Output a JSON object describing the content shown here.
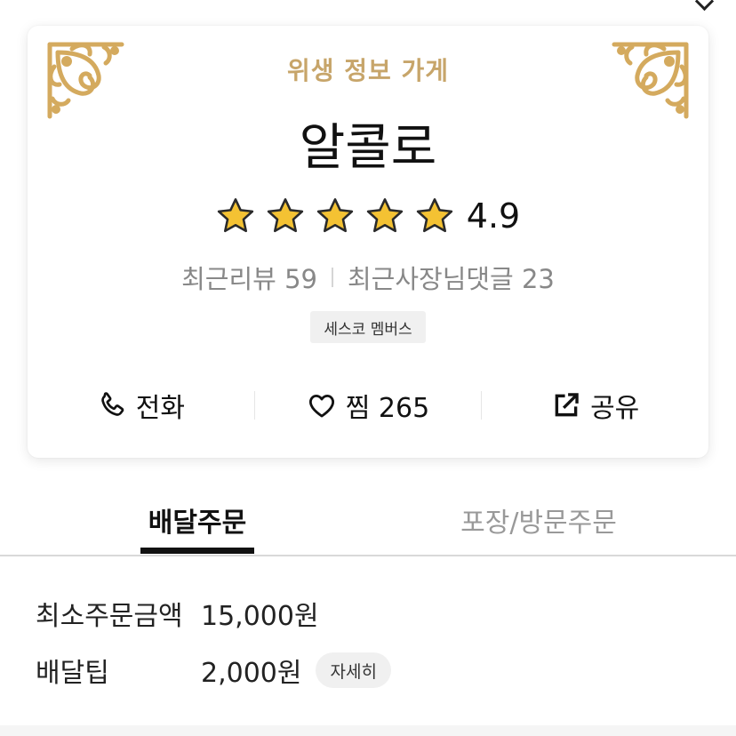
{
  "store": {
    "hygiene_label": "위생 정보 가게",
    "name": "알콜로",
    "rating": "4.9",
    "rating_stars": 5,
    "recent_reviews_label": "최근리뷰 59",
    "recent_owner_replies_label": "최근사장님댓글 23",
    "member_badge": "세스코 멤버스"
  },
  "actions": {
    "call_label": "전화",
    "favorite_label": "찜 265",
    "share_label": "공유"
  },
  "tabs": [
    {
      "label": "배달주문",
      "active": true
    },
    {
      "label": "포장/방문주문",
      "active": false
    }
  ],
  "delivery": {
    "min_order_label": "최소주문금액",
    "min_order_value": "15,000원",
    "tip_label": "배달팁",
    "tip_value": "2,000원",
    "detail_button": "자세히"
  },
  "colors": {
    "gold": "#c7a56a",
    "star": "#f4c233",
    "text": "#111111",
    "muted": "#888888"
  },
  "icons": [
    "gold-ornament-icon",
    "star-icon",
    "phone-icon",
    "heart-icon",
    "share-icon",
    "chevron-down-icon"
  ]
}
